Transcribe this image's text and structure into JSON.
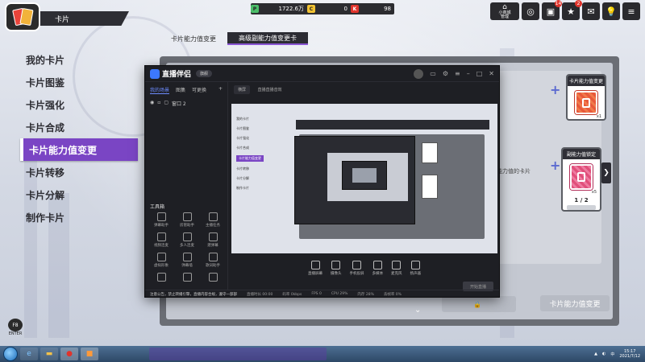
{
  "header": {
    "title": "卡片"
  },
  "currency": [
    {
      "icon": "P",
      "value": "1722.6万",
      "color": "#4cbf6a"
    },
    {
      "icon": "C",
      "value": "0",
      "color": "#f1c232"
    },
    {
      "icon": "K",
      "value": "98",
      "color": "#e0342c"
    }
  ],
  "top_right": {
    "shop_label": "小商城\n管理",
    "badges": [
      "14",
      "2"
    ]
  },
  "menu": [
    {
      "label": "我的卡片"
    },
    {
      "label": "卡片图鉴"
    },
    {
      "label": "卡片强化"
    },
    {
      "label": "卡片合成"
    },
    {
      "label": "卡片能力值变更"
    },
    {
      "label": "卡片转移"
    },
    {
      "label": "卡片分解"
    },
    {
      "label": "制作卡片"
    }
  ],
  "tabs": [
    "卡片能力值变更",
    "高级副能力值变更卡"
  ],
  "slots": {
    "top_title": "卡片能力值变更",
    "top_count": "x1",
    "bottom_title": "副能力值锁定",
    "bottom_count": "x5",
    "progress": "1 / 2",
    "center_hint": "能力值的卡片"
  },
  "buttons": {
    "change": "卡片能力值变更"
  },
  "app_window": {
    "name": "直播伴侣",
    "version": "旗舰",
    "left_tabs": [
      "我的场景",
      "图集",
      "可更换"
    ],
    "scene": "窗口 2",
    "tools_title": "工具箱",
    "tools": [
      "弹幕助手",
      "房管助手",
      "主播任务",
      "视频连麦",
      "多人连麦",
      "建弹幕",
      "虚拟形象",
      "弹幕墙",
      "歌词助手",
      "",
      "",
      ""
    ],
    "preview_tab": "横屏",
    "preview_sub": "直播直播音效",
    "bottom_tools": [
      "直播屏幕",
      "摄像头",
      "手机投屏",
      "多媒体",
      "麦克风",
      "扬声器"
    ],
    "live_btn": "开始直播",
    "status_notice": "注意公告，禁止转播引擎，直播内容合规，遵守一部部",
    "status": [
      "直播时长 00:00",
      "码率 0kbps",
      "FPS 0",
      "CPU 29%",
      "内存 28%",
      "丢帧率 0%"
    ],
    "nested_menu": [
      "我的卡片",
      "卡片图鉴",
      "卡片强化",
      "卡片合成",
      "卡片能力值变更",
      "卡片转移",
      "卡片分解",
      "制作卡片"
    ]
  },
  "fs_badge": {
    "ring": "F8",
    "label": "ENTER"
  },
  "taskbar": {
    "time": "15:17",
    "date": "2021/7/12"
  }
}
